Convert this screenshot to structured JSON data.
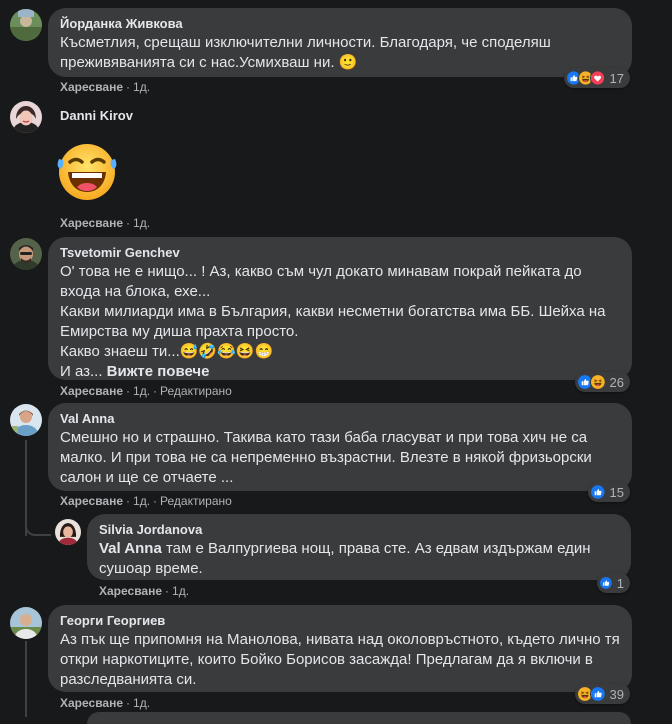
{
  "comments": [
    {
      "author": "Йорданка Живкова",
      "lines": [
        "Късметлия, срещаш изключителни личности. Благодаря, че споделяш",
        "преживяванията си с нас.Усмихваш ни. 🙂"
      ],
      "like_label": "Харесване",
      "time": "1д.",
      "reactions": [
        "like",
        "haha",
        "love"
      ],
      "count": "17"
    },
    {
      "author": "Danni Kirov",
      "sticker": "laughing-face",
      "like_label": "Харесване",
      "time": "1д."
    },
    {
      "author": "Tsvetomir Genchev",
      "lines": [
        "О' това не е нищо... ! Аз, какво съм чул докато минавам покрай пейката до",
        "входа на блока, ехе...",
        "Какви милиарди има в България, какви несметни богатства има ББ. Шейха на",
        "Емирства му диша прахта просто.",
        "Какво знаеш ти...😅🤣😂😆😁"
      ],
      "last_line_prefix": "И аз... ",
      "see_more": "Вижте повече",
      "like_label": "Харесване",
      "time": "1д.",
      "edited": "Редактирано",
      "reactions": [
        "like",
        "haha"
      ],
      "count": "26"
    },
    {
      "author": "Val Anna",
      "lines": [
        "Смешно но и страшно. Такива като тази баба гласуват и при това хич не са",
        "малко. И при това не са непременно възрастни. Влезте в някой фризьорски",
        "салон и ще се отчаете ..."
      ],
      "like_label": "Харесване",
      "time": "1д.",
      "edited": "Редактирано",
      "reactions": [
        "like"
      ],
      "count": "15"
    },
    {
      "author": "Silvia Jordanova",
      "mention": "Val Anna",
      "line1_rest": " там е Валпургиева нощ, права сте. Аз едвам издържам един",
      "line2": "сушоар време.",
      "like_label": "Харесване",
      "time": "1д.",
      "reactions": [
        "like"
      ],
      "count": "1"
    },
    {
      "author": "Георги Георгиев",
      "lines": [
        "Аз пък ще припомня на Манолова, нивата над околовръстното, където лично тя",
        "откри наркотиците, които Бойко Борисов засажда! Предлагам да я включи в",
        "разследванията си."
      ],
      "like_label": "Харесване",
      "time": "1д.",
      "reactions": [
        "haha",
        "like"
      ],
      "count": "39"
    }
  ],
  "separator": "·",
  "colors": {
    "like": "#1877f2",
    "love": "#f33e58",
    "haha": "#f7b125"
  }
}
